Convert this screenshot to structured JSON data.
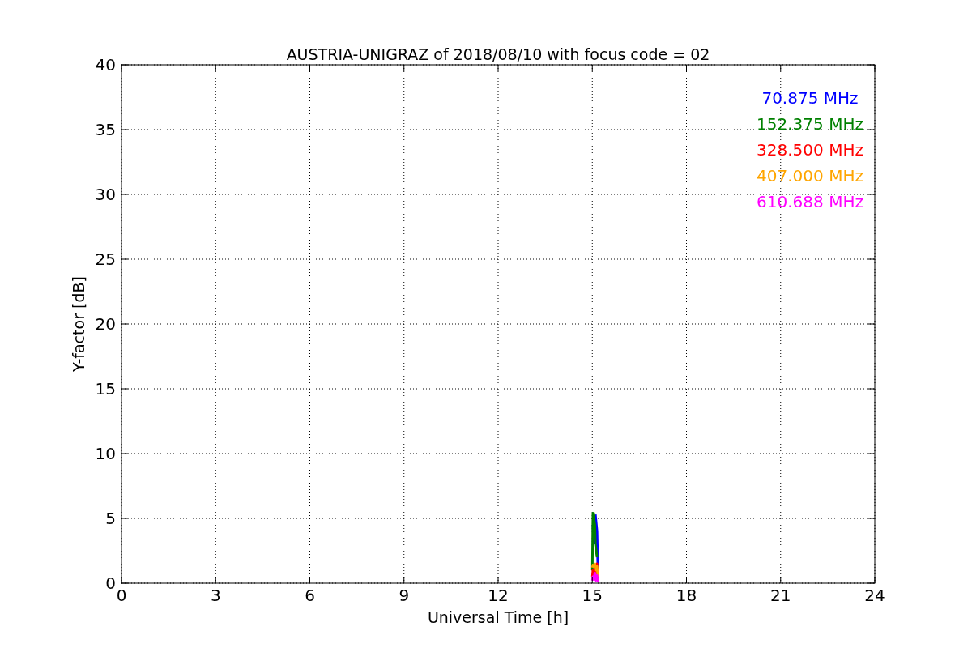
{
  "chart_data": {
    "type": "line",
    "title": "AUSTRIA-UNIGRAZ of 2018/08/10 with focus code = 02",
    "xlabel": "Universal Time [h]",
    "ylabel": "Y-factor [dB]",
    "x": [
      15.0,
      15.02,
      15.05,
      15.08,
      15.1,
      15.15,
      15.18
    ],
    "series": [
      {
        "name": "70.875 MHz",
        "color": "#0000ff",
        "values": [
          null,
          4.5,
          3,
          null,
          5.3,
          4,
          1
        ]
      },
      {
        "name": "152.375 MHz",
        "color": "#008000",
        "values": [
          1,
          5.4,
          5,
          4.5,
          3,
          2,
          null
        ]
      },
      {
        "name": "328.500 MHz",
        "color": "#ff0000",
        "values": [
          0.5,
          1,
          0.8,
          1.2,
          0.6,
          1.5,
          0.3
        ]
      },
      {
        "name": "407.000 MHz",
        "color": "#ffa500",
        "values": [
          1.2,
          1.4,
          1.3,
          1.5,
          1,
          1.3,
          0.5
        ]
      },
      {
        "name": "610.688 MHz",
        "color": "#ff00ff",
        "values": [
          0.2,
          0.5,
          0.3,
          0.8,
          0.2,
          0.6,
          0.1
        ]
      }
    ],
    "xlim": [
      0,
      24
    ],
    "ylim": [
      0,
      40
    ],
    "xticks": [
      0,
      3,
      6,
      9,
      12,
      15,
      18,
      21,
      24
    ],
    "yticks": [
      0,
      5,
      10,
      15,
      20,
      25,
      30,
      35,
      40
    ],
    "grid": true
  }
}
